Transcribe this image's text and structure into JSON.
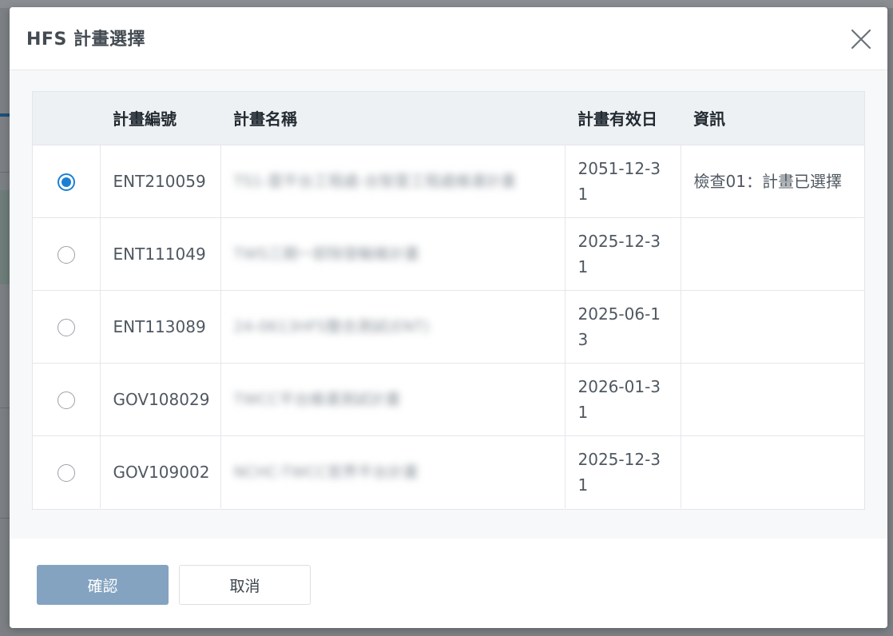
{
  "modal": {
    "title": "HFS 計畫選擇",
    "close_icon": "close-icon"
  },
  "table": {
    "headers": {
      "select": "",
      "code": "計畫編號",
      "name": "計畫名稱",
      "expiry": "計畫有效日",
      "info": "資訊"
    },
    "rows": [
      {
        "selected": true,
        "code": "ENT210059",
        "name": "TS1-雲平台工程處-台智雲工程處維運計畫",
        "expiry": "2051-12-31",
        "info": "檢查01：計畫已選擇"
      },
      {
        "selected": false,
        "code": "ENT111049",
        "name": "TWS三期一卸除發輸維計畫",
        "expiry": "2025-12-31",
        "info": ""
      },
      {
        "selected": false,
        "code": "ENT113089",
        "name": "24-0613HFS整合測試(ENT)",
        "expiry": "2025-06-13",
        "info": ""
      },
      {
        "selected": false,
        "code": "GOV108029",
        "name": "TWCC平台維運測試計畫",
        "expiry": "2026-01-31",
        "info": ""
      },
      {
        "selected": false,
        "code": "GOV109002",
        "name": "NCHC-TWCC官界平台計畫",
        "expiry": "2025-12-31",
        "info": ""
      }
    ]
  },
  "footer": {
    "confirm_label": "確認",
    "cancel_label": "取消"
  },
  "colors": {
    "accent": "#1a7fd4",
    "confirm_button": "#84a3c1",
    "header_bg": "#eef1f4"
  }
}
